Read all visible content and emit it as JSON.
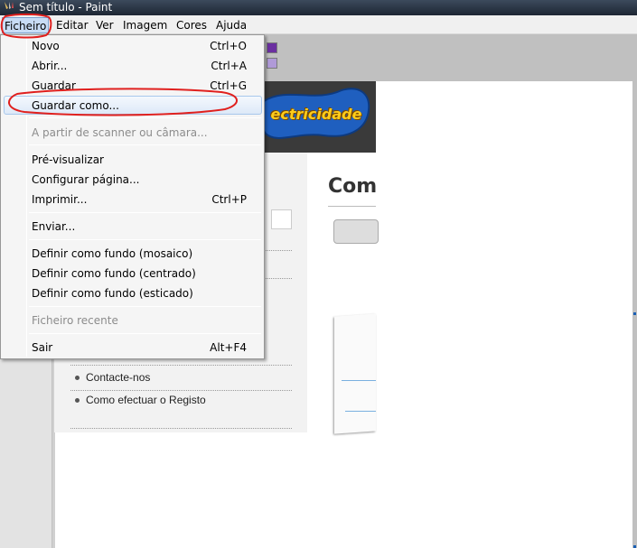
{
  "window": {
    "title": "Sem título - Paint"
  },
  "menubar": {
    "items": [
      {
        "label": "Ficheiro"
      },
      {
        "label": "Editar"
      },
      {
        "label": "Ver"
      },
      {
        "label": "Imagem"
      },
      {
        "label": "Cores"
      },
      {
        "label": "Ajuda"
      }
    ]
  },
  "file_menu": {
    "items": [
      {
        "label": "Novo",
        "accel": "Ctrl+O"
      },
      {
        "label": "Abrir...",
        "accel": "Ctrl+A"
      },
      {
        "label": "Guardar",
        "accel": "Ctrl+G"
      },
      {
        "label": "Guardar como...",
        "accel": ""
      },
      {
        "label": "A partir de scanner ou câmara...",
        "accel": ""
      },
      {
        "label": "Pré-visualizar",
        "accel": ""
      },
      {
        "label": "Configurar página...",
        "accel": ""
      },
      {
        "label": "Imprimir...",
        "accel": "Ctrl+P"
      },
      {
        "label": "Enviar...",
        "accel": ""
      },
      {
        "label": "Definir como fundo (mosaico)",
        "accel": ""
      },
      {
        "label": "Definir como fundo (centrado)",
        "accel": ""
      },
      {
        "label": "Definir como fundo (esticado)",
        "accel": ""
      },
      {
        "label": "Ficheiro recente",
        "accel": ""
      },
      {
        "label": "Sair",
        "accel": "Alt+F4"
      }
    ]
  },
  "palette": {
    "colors": [
      "#6b2fa0",
      "#b09ad8"
    ]
  },
  "canvas_image": {
    "logo_text": "ectricidade",
    "heading": "Com",
    "side_links": [
      "Contacte-nos",
      "Como efectuar o Registo"
    ]
  },
  "colors": {
    "annotation": "#e0201e",
    "highlight": "#c8dcf5"
  }
}
